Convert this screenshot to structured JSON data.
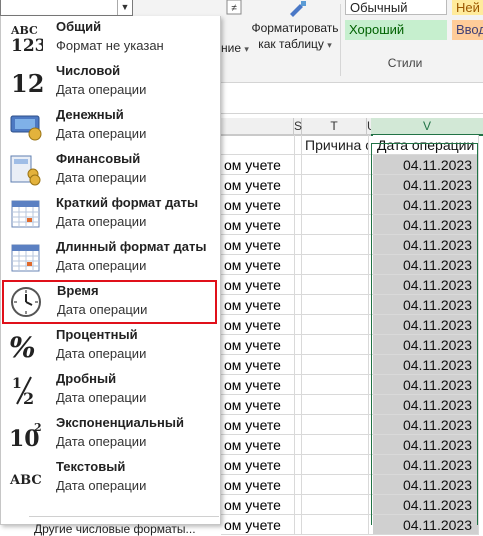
{
  "ribbon": {
    "conditional_formatting_fragment": "ние",
    "format_as_table": "Форматировать как таблицу",
    "styles_label": "Стили",
    "style_normal": "Обычный",
    "style_neutral": "Ней",
    "style_good": "Хороший",
    "style_input": "Ввод"
  },
  "columns": {
    "s": "S",
    "t": "T",
    "u": "U",
    "v": "V"
  },
  "header_cells": {
    "t": "Причина с",
    "v": "Дата операции"
  },
  "rows": {
    "r_fragment": "ом учете",
    "date": "04.11.2023"
  },
  "format_menu": {
    "items": [
      {
        "title": "Общий",
        "subtitle": "Формат не указан",
        "icon": "abc-123-icon"
      },
      {
        "title": "Числовой",
        "subtitle": "Дата операции",
        "icon": "number-12-icon"
      },
      {
        "title": "Денежный",
        "subtitle": "Дата операции",
        "icon": "currency-icon"
      },
      {
        "title": "Финансовый",
        "subtitle": "Дата операции",
        "icon": "accounting-icon"
      },
      {
        "title": "Краткий формат даты",
        "subtitle": "Дата операции",
        "icon": "calendar-icon"
      },
      {
        "title": "Длинный формат даты",
        "subtitle": "Дата операции",
        "icon": "calendar-icon"
      },
      {
        "title": "Время",
        "subtitle": "Дата операции",
        "icon": "clock-icon"
      },
      {
        "title": "Процентный",
        "subtitle": "Дата операции",
        "icon": "percent-icon"
      },
      {
        "title": "Дробный",
        "subtitle": "Дата операции",
        "icon": "fraction-icon"
      },
      {
        "title": "Экспоненциальный",
        "subtitle": "Дата операции",
        "icon": "scientific-icon"
      },
      {
        "title": "Текстовый",
        "subtitle": "Дата операции",
        "icon": "abc-text-icon"
      }
    ],
    "more_formats": "Другие числовые форматы...",
    "highlighted_item": "Время",
    "highlight_color": "#e0101a"
  }
}
